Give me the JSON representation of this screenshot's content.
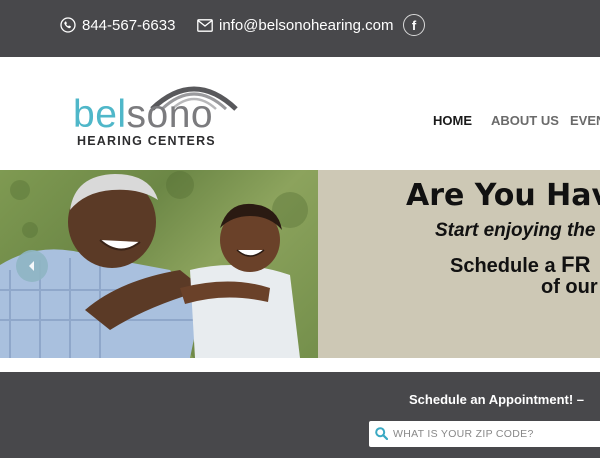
{
  "topbar": {
    "phone": "844-567-6633",
    "email": "info@belsonohearing.com",
    "facebook_icon": "facebook-icon",
    "phone_icon": "phone-icon",
    "email_icon": "envelope-icon"
  },
  "logo": {
    "part1": "bel",
    "part2": "sono",
    "subtitle": "HEARING CENTERS",
    "colors": {
      "bel": "#4fb7c9",
      "sono": "#7b7b7e"
    }
  },
  "nav": {
    "items": [
      {
        "label": "HOME",
        "active": true
      },
      {
        "label": "ABOUT US",
        "active": false
      },
      {
        "label": "EVEN",
        "active": false
      }
    ]
  },
  "hero": {
    "line1": "Are You Hav",
    "line2": "Start enjoying the",
    "line3_prefix": "Schedule a ",
    "line3_bold": "FR",
    "line4": "of our",
    "prev_icon": "chevron-left-icon"
  },
  "schedule": {
    "title": "Schedule an Appointment! –",
    "zip_placeholder": "WHAT IS YOUR ZIP CODE?",
    "search_icon": "search-icon"
  },
  "colors": {
    "topbar_bg": "#48484b",
    "accent": "#4fb7c9",
    "promo_bg": "#cdc8b5"
  }
}
